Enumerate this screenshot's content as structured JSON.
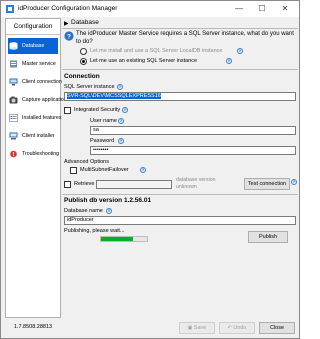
{
  "window": {
    "title": "idProducer Configuration Manager",
    "controls": {
      "minimize": "—",
      "maximize": "☐",
      "close": "✕"
    }
  },
  "sidebar": {
    "header": "Configuration",
    "items": [
      {
        "label": "Database",
        "icon": "database-icon",
        "active": true
      },
      {
        "label": "Master service",
        "icon": "master-service-icon"
      },
      {
        "label": "Client connection",
        "icon": "client-connection-icon"
      },
      {
        "label": "Capture application",
        "icon": "capture-application-icon"
      },
      {
        "label": "Installed features",
        "icon": "installed-features-icon"
      },
      {
        "label": "Client installer",
        "icon": "client-installer-icon"
      },
      {
        "label": "Troubleshooting",
        "icon": "troubleshooting-icon"
      }
    ],
    "version": "1.7.8508.28813"
  },
  "database": {
    "title": "Database",
    "info_text": "The idProducer Master Service requires a SQL Server instance, what do you want to do?",
    "option_localdb": "Let me install and use a SQL Server LocalDB instance",
    "option_existing": "Let me use an existing SQL Server instance"
  },
  "connection": {
    "title": "Connection",
    "instance_label": "SQL Server instance",
    "instance_value": "SVR-SQL\\DEV\\MCSSQLEXPRESS16",
    "integrated_security_label": "Integrated Security",
    "username_label": "User name",
    "username_value": "sa",
    "password_label": "Password",
    "password_value": "••••••••",
    "advanced_label": "Advanced Options",
    "multisubnet_label": "MultiSubnetFailover",
    "retrieve_label": "Retrieve",
    "db_version_label": "database version",
    "db_version_value": "unknown",
    "test_button": "Test connection"
  },
  "publish": {
    "title": "Publish db version 1.2.56.01",
    "db_name_label": "Database name",
    "db_name_value": "idProducer",
    "status_text": "Publishing, please wait...",
    "progress": 0.7,
    "publish_button": "Publish"
  },
  "footer": {
    "save": "Save",
    "undo": "Undo",
    "close": "Close"
  },
  "colors": {
    "accent": "#0a64d8",
    "progress": "#06b025"
  }
}
